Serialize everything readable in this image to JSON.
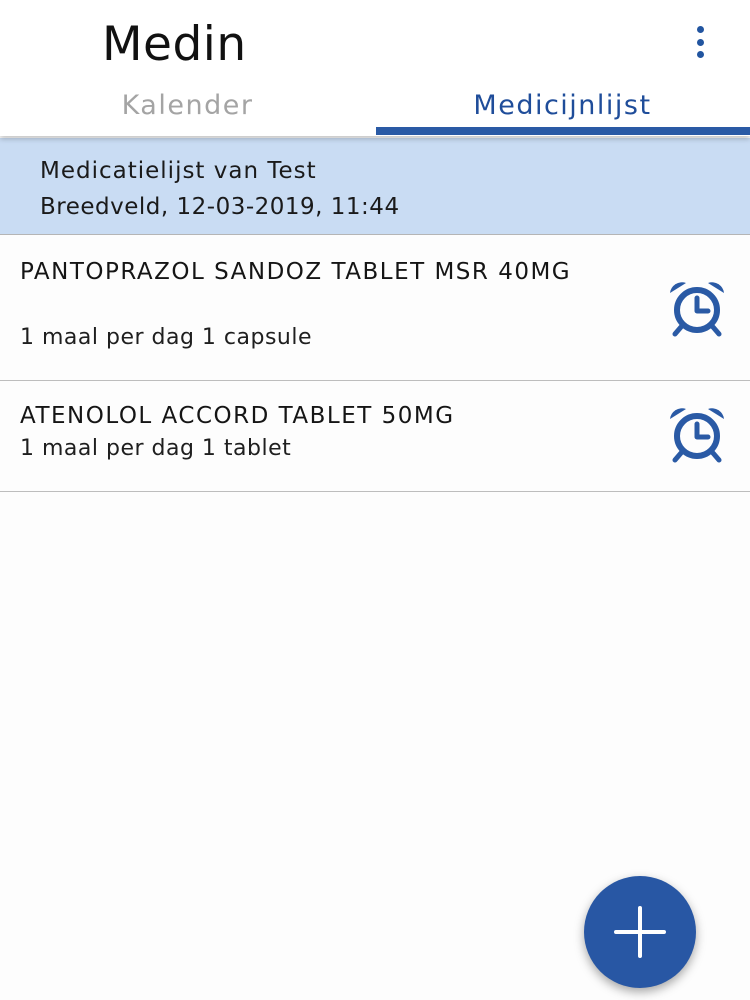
{
  "app": {
    "title": "Medin"
  },
  "tabs": [
    {
      "label": "Kalender",
      "selected": false
    },
    {
      "label": "Medicijnlijst",
      "selected": true
    }
  ],
  "list_header": {
    "title": "Medicatielijst van Test",
    "subtitle": "Breedveld, 12-03-2019, 11:44"
  },
  "medications": [
    {
      "name": "PANTOPRAZOL SANDOZ TABLET MSR 40MG",
      "dosage": "1 maal per dag 1 capsule",
      "icon": "alarm-clock-icon"
    },
    {
      "name": "ATENOLOL ACCORD TABLET 50MG",
      "dosage": "1 maal per dag 1 tablet",
      "icon": "alarm-clock-icon"
    }
  ],
  "fab": {
    "icon": "plus-icon"
  },
  "menu": {
    "icon": "more-vertical-icon"
  },
  "colors": {
    "accent": "#2a5aa5",
    "header_bg": "#c9dcf3",
    "tab_inactive": "#a4a4a4"
  }
}
